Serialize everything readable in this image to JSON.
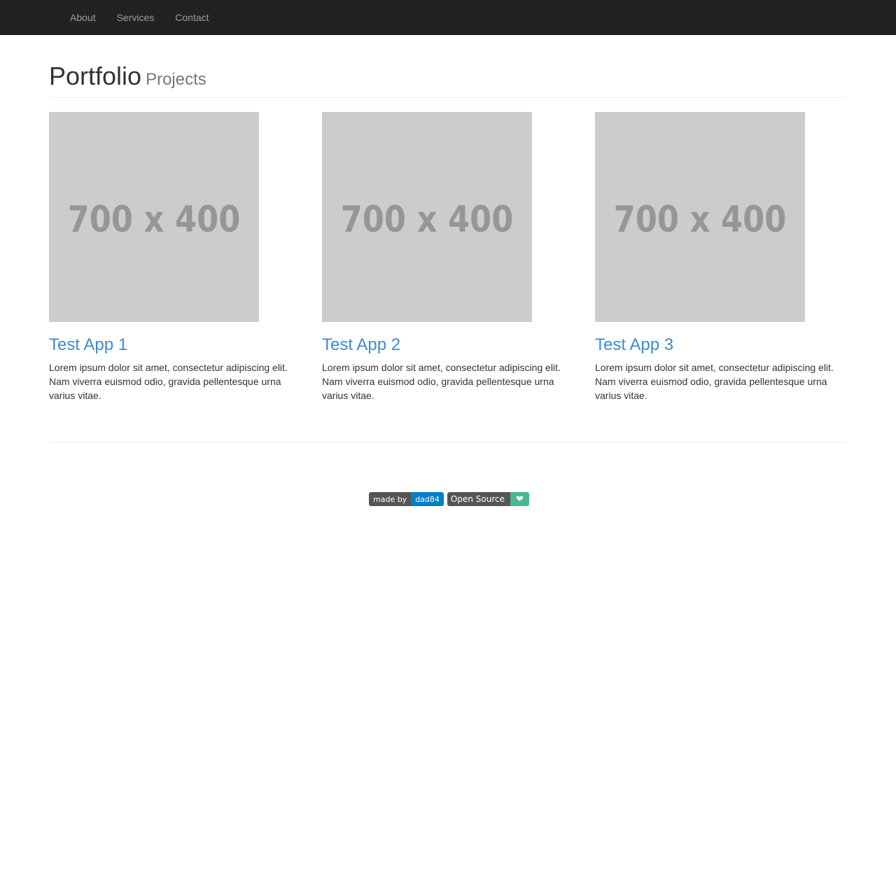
{
  "nav": {
    "items": [
      "About",
      "Services",
      "Contact"
    ]
  },
  "header": {
    "title": "Portfolio",
    "subtitle": "Projects"
  },
  "projects": [
    {
      "image_label": "700 x 400",
      "title": "Test App 1",
      "description": "Lorem ipsum dolor sit amet, consectetur adipiscing elit. Nam viverra euismod odio, gravida pellentesque urna varius vitae."
    },
    {
      "image_label": "700 x 400",
      "title": "Test App 2",
      "description": "Lorem ipsum dolor sit amet, consectetur adipiscing elit. Nam viverra euismod odio, gravida pellentesque urna varius vitae."
    },
    {
      "image_label": "700 x 400",
      "title": "Test App 3",
      "description": "Lorem ipsum dolor sit amet, consectetur adipiscing elit. Nam viverra euismod odio, gravida pellentesque urna varius vitae."
    }
  ],
  "footer": {
    "badge_made_by": {
      "label": "made by",
      "value": "dad84"
    },
    "badge_open_source": {
      "label": "Open Source",
      "value": "❤"
    }
  },
  "colors": {
    "navbar_bg": "#222222",
    "link": "#428bca",
    "placeholder_bg": "#cccccc",
    "badge_blue": "#007ec6",
    "badge_green": "#47b88f"
  }
}
